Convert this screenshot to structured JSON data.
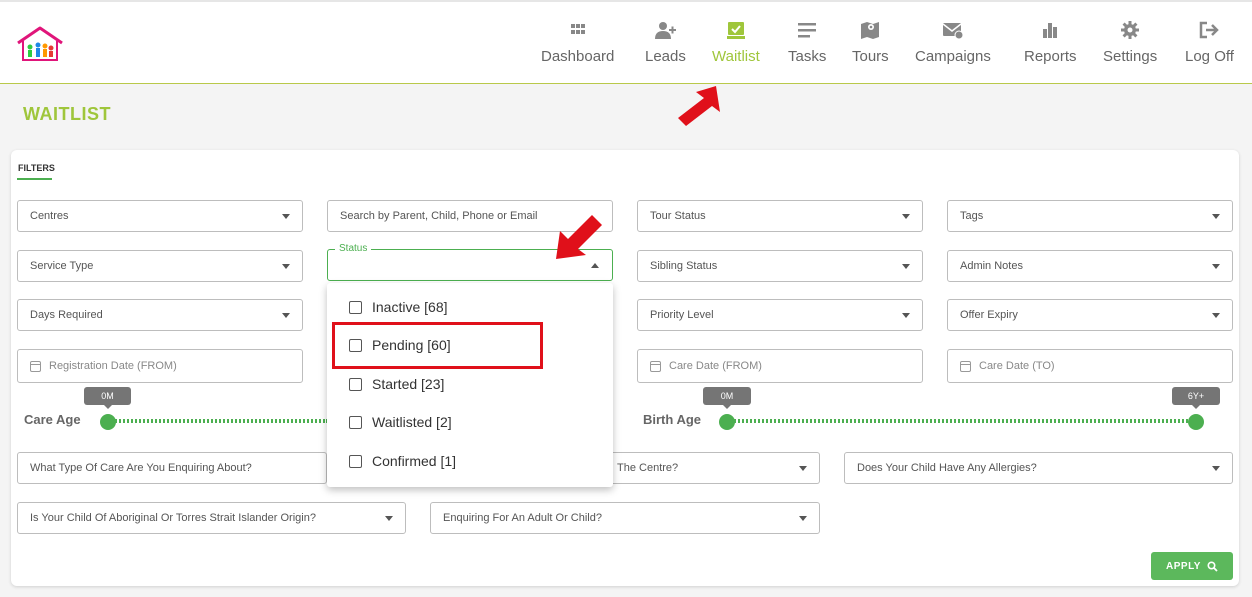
{
  "nav": {
    "items": [
      {
        "label": "Dashboard",
        "icon": "grid-icon"
      },
      {
        "label": "Leads",
        "icon": "add-user-icon"
      },
      {
        "label": "Waitlist",
        "icon": "checklist-icon"
      },
      {
        "label": "Tasks",
        "icon": "list-icon"
      },
      {
        "label": "Tours",
        "icon": "map-icon"
      },
      {
        "label": "Campaigns",
        "icon": "envelope-icon"
      },
      {
        "label": "Reports",
        "icon": "bar-chart-icon"
      },
      {
        "label": "Settings",
        "icon": "gear-icon"
      },
      {
        "label": "Log Off",
        "icon": "logout-icon"
      }
    ],
    "active": "Waitlist"
  },
  "page": {
    "title": "WAITLIST",
    "filters_tab": "FILTERS"
  },
  "fields": {
    "centres": "Centres",
    "search_placeholder": "Search by Parent, Child, Phone or Email",
    "tour_status": "Tour Status",
    "tags": "Tags",
    "service_type": "Service Type",
    "status_label": "Status",
    "sibling_status": "Sibling Status",
    "admin_notes": "Admin Notes",
    "days_required": "Days Required",
    "priority_level": "Priority Level",
    "offer_expiry": "Offer Expiry",
    "registration_date_from": "Registration Date (FROM)",
    "care_date_from": "Care Date (FROM)",
    "care_date_to": "Care Date (TO)",
    "care_type_question": "What Type Of Care Are You Enquiring About?",
    "centre_question_partial": "The Centre?",
    "allergies_question": "Does Your Child Have Any Allergies?",
    "aboriginal_question": "Is Your Child Of Aboriginal Or Torres Strait Islander Origin?",
    "adult_child_question": "Enquiring For An Adult Or Child?"
  },
  "status_options": [
    {
      "label": "Inactive [68]",
      "checked": false
    },
    {
      "label": "Pending [60]",
      "checked": false
    },
    {
      "label": "Started [23]",
      "checked": false
    },
    {
      "label": "Waitlisted [2]",
      "checked": false
    },
    {
      "label": "Confirmed [1]",
      "checked": false
    }
  ],
  "sliders": {
    "care_age": {
      "label": "Care Age",
      "min_label": "0M"
    },
    "birth_age": {
      "label": "Birth Age",
      "min_label": "0M",
      "max_label": "6Y+"
    }
  },
  "buttons": {
    "apply": "APPLY"
  },
  "colors": {
    "accent": "#9fc63b",
    "green": "#4caf50",
    "highlight": "#e0101a"
  }
}
